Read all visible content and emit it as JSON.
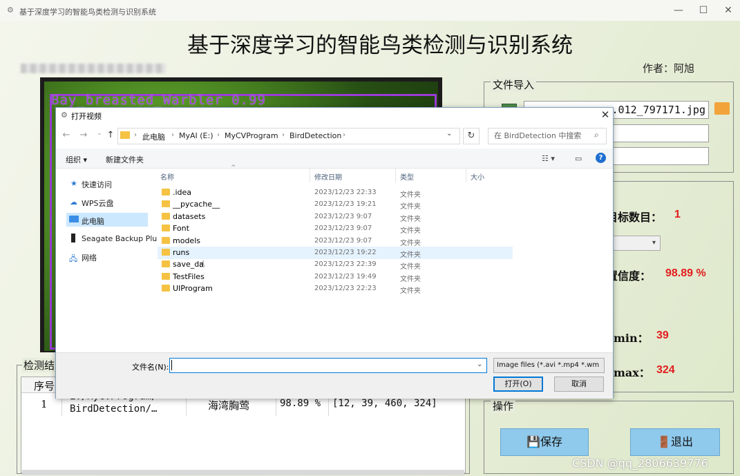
{
  "window": {
    "title": "基于深度学习的智能鸟类检测与识别系统",
    "heading": "基于深度学习的智能鸟类检测与识别系统",
    "author": "作者：阿旭",
    "minimize": "—",
    "maximize": "☐",
    "close": "✕"
  },
  "image": {
    "detection_label": "Bay_breasted_Warbler 0.99"
  },
  "file_import": {
    "label": "文件导入",
    "file_value": "...012_797171.jpg"
  },
  "result": {
    "target_count_label": "目标数目：",
    "target_count_value": "1",
    "confidence_label": "置信度：",
    "confidence_value": "98.89 %",
    "xmin_label": "min：",
    "xmin_value": "39",
    "xmax_label": "max：",
    "xmax_value": "324"
  },
  "operations": {
    "label": "操作",
    "save": "保存",
    "exit": "退出"
  },
  "results_table": {
    "label": "检测结",
    "header_index": "序号",
    "rows": [
      {
        "index": "1",
        "path_line1": "E:/MyCVProgram/",
        "path_line2": "BirdDetection/…",
        "class": "海湾胸莺",
        "confidence": "98.89 %",
        "box": "[12, 39, 460, 324]"
      }
    ]
  },
  "watermark": "CSDN @qq_2806639776",
  "dialog": {
    "title": "打开视频",
    "close": "✕",
    "breadcrumbs": [
      "此电脑",
      "MyAI (E:)",
      "MyCVProgram",
      "BirdDetection"
    ],
    "search_placeholder": "在 BirdDetection 中搜索",
    "toolbar": {
      "organize": "组织 ▾",
      "new_folder": "新建文件夹"
    },
    "nav": [
      {
        "label": "快速访问",
        "icon": "star-icon"
      },
      {
        "label": "WPS云盘",
        "icon": "cloud-icon"
      },
      {
        "label": "此电脑",
        "icon": "computer-icon"
      },
      {
        "label": "Seagate Backup Plu",
        "icon": "drive-icon"
      },
      {
        "label": "网络",
        "icon": "network-icon"
      }
    ],
    "columns": {
      "name": "名称",
      "date": "修改日期",
      "type": "类型",
      "size": "大小"
    },
    "files": [
      {
        "name": ".idea",
        "date": "2023/12/23 22:33",
        "type": "文件夹"
      },
      {
        "name": "__pycache__",
        "date": "2023/12/23 19:21",
        "type": "文件夹"
      },
      {
        "name": "datasets",
        "date": "2023/12/23 9:07",
        "type": "文件夹"
      },
      {
        "name": "Font",
        "date": "2023/12/23 9:07",
        "type": "文件夹"
      },
      {
        "name": "models",
        "date": "2023/12/23 9:07",
        "type": "文件夹"
      },
      {
        "name": "runs",
        "date": "2023/12/23 19:22",
        "type": "文件夹"
      },
      {
        "name": "save_da",
        "date": "2023/12/23 22:39",
        "type": "文件夹"
      },
      {
        "name": "TestFiles",
        "date": "2023/12/23 19:49",
        "type": "文件夹"
      },
      {
        "name": "UIProgram",
        "date": "2023/12/23 22:23",
        "type": "文件夹"
      }
    ],
    "filename_label": "文件名(N):",
    "filename_value": "",
    "filter": "Image files (*.avi *.mp4 *.wm",
    "open": "打开(O)",
    "cancel": "取消"
  }
}
